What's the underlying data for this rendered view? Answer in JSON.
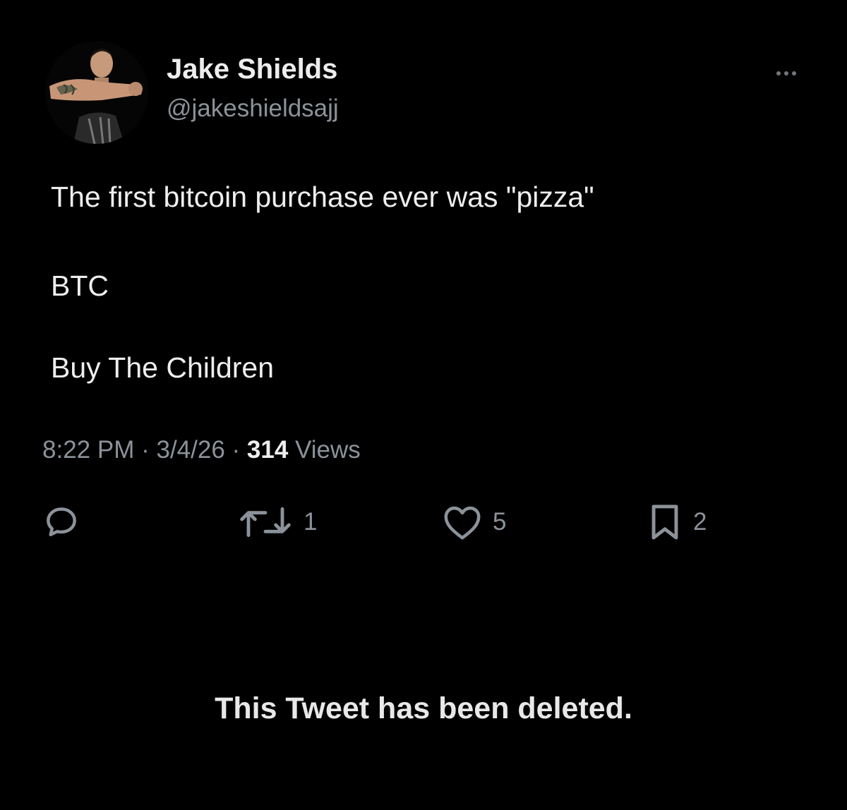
{
  "author": {
    "display_name": "Jake Shields",
    "handle": "@jakeshieldsajj",
    "avatar_icon": "profile-photo"
  },
  "more_icon": "more-horizontal-icon",
  "tweet": {
    "lines": [
      "The first bitcoin purchase ever was \"pizza\"",
      "BTC",
      "Buy The Children"
    ]
  },
  "meta": {
    "time": "8:22 PM",
    "separator": "·",
    "date": "3/4/26",
    "views_count": "314",
    "views_label": "Views"
  },
  "actions": {
    "reply": {
      "icon": "reply-icon"
    },
    "retweet": {
      "icon": "retweet-icon",
      "count": "1"
    },
    "like": {
      "icon": "heart-icon",
      "count": "5"
    },
    "bookmark": {
      "icon": "bookmark-icon",
      "count": "2"
    }
  },
  "deleted_notice": "This Tweet has been deleted.",
  "colors": {
    "background": "#000000",
    "primary_text": "#e7e9ea",
    "secondary_text": "#8b9299",
    "icon": "#8b9299"
  }
}
